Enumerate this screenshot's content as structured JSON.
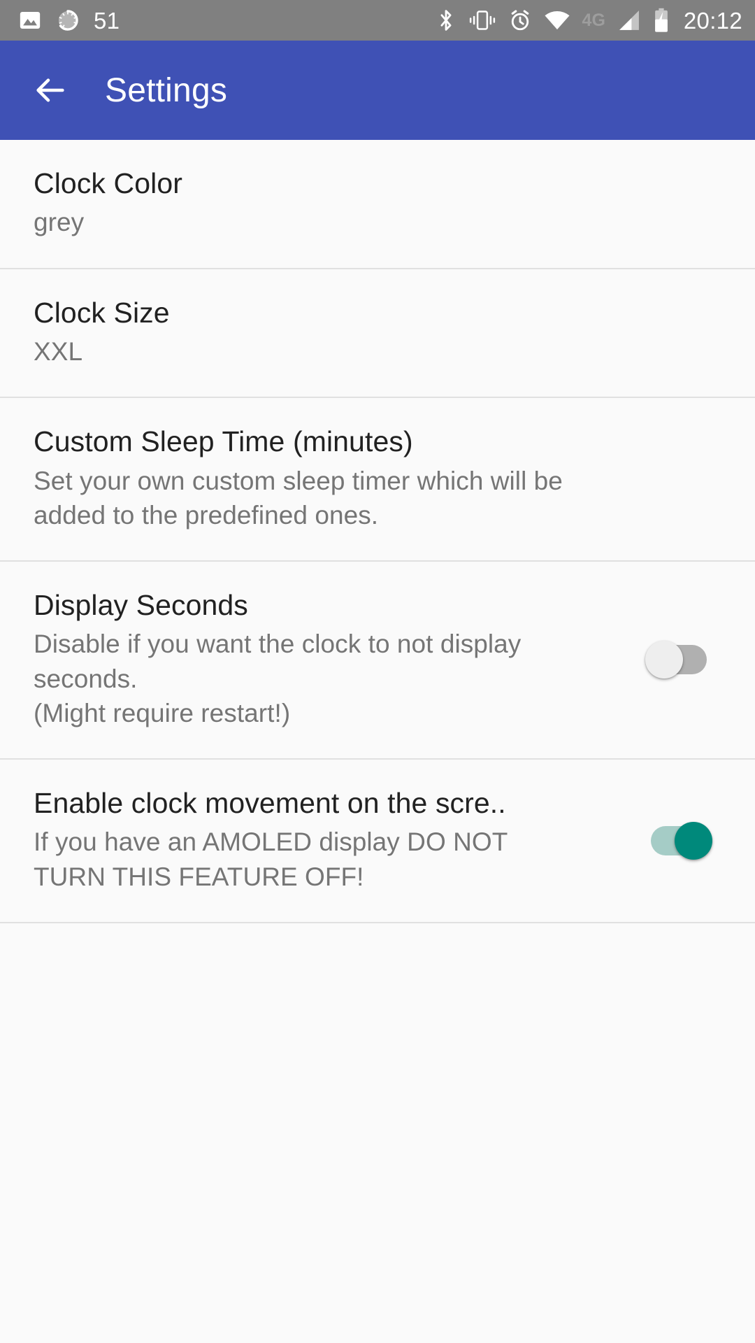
{
  "status_bar": {
    "background_color": "#808080",
    "left_icons": [
      "image-icon",
      "sync-spinner-icon"
    ],
    "notification_count": "51",
    "right_icons": [
      "bluetooth-icon",
      "vibrate-icon",
      "alarm-icon",
      "wifi-icon"
    ],
    "network_type": "4G",
    "signal_icon": "cellular-signal-icon",
    "battery_icon": "battery-charging-icon",
    "clock": "20:12"
  },
  "app_bar": {
    "title": "Settings",
    "back_icon": "back-arrow-icon",
    "background_color": "#3f51b5",
    "text_color": "#ffffff"
  },
  "preferences": [
    {
      "title": "Clock Color",
      "summary": "grey",
      "widget": "none"
    },
    {
      "title": "Clock Size",
      "summary": "XXL",
      "widget": "none"
    },
    {
      "title": "Custom Sleep Time (minutes)",
      "summary": "Set your own custom sleep timer which will be\nadded to the predefined ones.",
      "widget": "none"
    },
    {
      "title": "Display Seconds",
      "summary": "Disable if you want the clock to not display\nseconds.\n(Might require restart!)",
      "widget": "switch",
      "switch_state": "off"
    },
    {
      "title": "Enable clock movement on the scre..",
      "summary": "If you have an AMOLED display DO NOT\nTURN THIS FEATURE OFF!",
      "widget": "switch",
      "switch_state": "on"
    }
  ],
  "colors": {
    "accent_on": "#00897b",
    "accent_on_track": "#a5ccc6",
    "switch_off_thumb": "#eeeeee",
    "switch_off_track": "#b0b0b0",
    "list_background": "#fafafa",
    "divider": "#e0e0e0",
    "title_text": "#212121",
    "summary_text": "#757575"
  }
}
